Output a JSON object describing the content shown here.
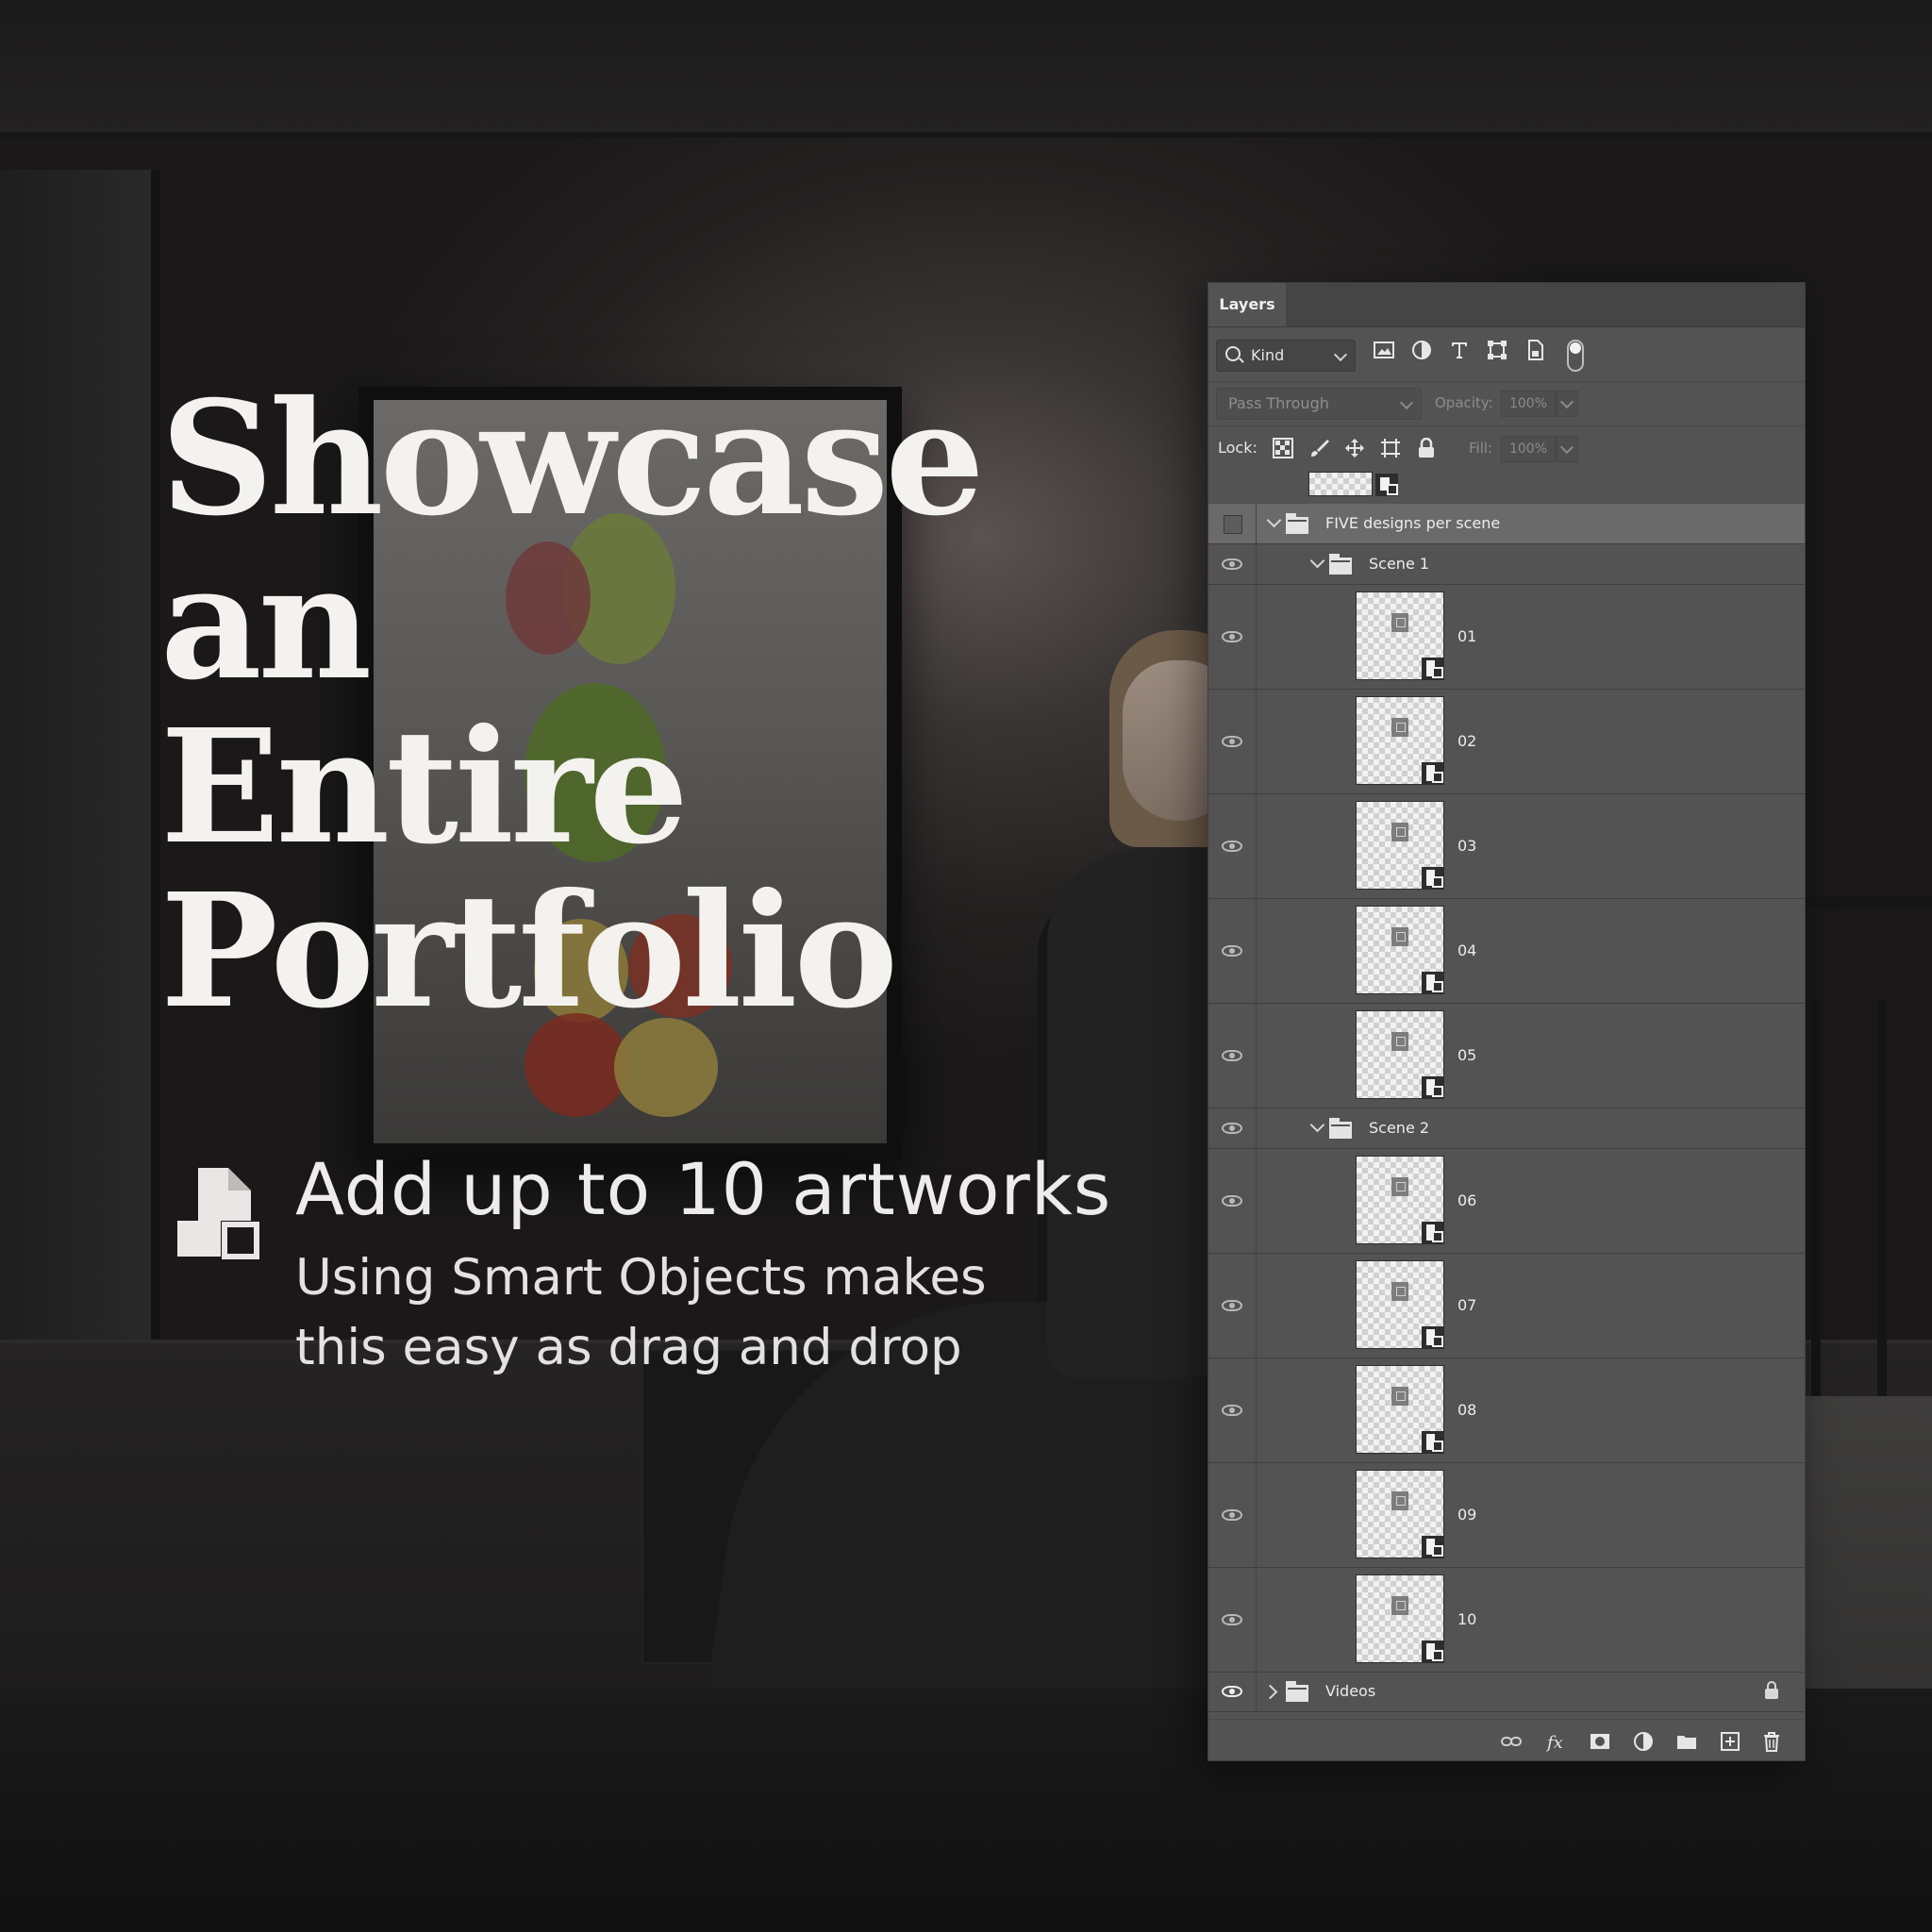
{
  "headline": [
    "Showcase",
    "an Entire",
    "Portfolio"
  ],
  "feature": {
    "icon": "smart-object-icon",
    "title": "Add up to 10 artworks",
    "subtitle": [
      "Using Smart Objects makes",
      "this easy as drag and drop"
    ]
  },
  "panel": {
    "tab": "Layers",
    "filter": {
      "kind_label": "Kind",
      "icons": [
        "image-filter-icon",
        "adjustment-filter-icon",
        "type-filter-icon",
        "shape-filter-icon",
        "smart-object-filter-icon"
      ]
    },
    "blend_mode": "Pass Through",
    "opacity_label": "Opacity:",
    "opacity_value": "100%",
    "lock_label": "Lock:",
    "fill_label": "Fill:",
    "fill_value": "100%",
    "lock_icons": [
      "lock-transparent-icon",
      "lock-paint-icon",
      "lock-move-icon",
      "lock-artboard-icon",
      "lock-all-icon"
    ],
    "layers": [
      {
        "kind": "group",
        "name": "FIVE designs per scene",
        "depth": 0,
        "selected": true,
        "visible": false,
        "expanded": true
      },
      {
        "kind": "group",
        "name": "Scene 1",
        "depth": 1,
        "visible": true,
        "expanded": true
      },
      {
        "kind": "smart",
        "name": "01",
        "visible": true
      },
      {
        "kind": "smart",
        "name": "02",
        "visible": true
      },
      {
        "kind": "smart",
        "name": "03",
        "visible": true
      },
      {
        "kind": "smart",
        "name": "04",
        "visible": true
      },
      {
        "kind": "smart",
        "name": "05",
        "visible": true
      },
      {
        "kind": "group",
        "name": "Scene 2",
        "depth": 1,
        "visible": true,
        "expanded": true
      },
      {
        "kind": "smart",
        "name": "06",
        "visible": true
      },
      {
        "kind": "smart",
        "name": "07",
        "visible": true
      },
      {
        "kind": "smart",
        "name": "08",
        "visible": true
      },
      {
        "kind": "smart",
        "name": "09",
        "visible": true
      },
      {
        "kind": "smart",
        "name": "10",
        "visible": true
      },
      {
        "kind": "group",
        "name": "Videos",
        "depth": 0,
        "visible": true,
        "expanded": false,
        "locked": true
      }
    ],
    "bottom_icons": [
      "link-layers-icon",
      "fx-icon",
      "layer-mask-icon",
      "adjustment-layer-icon",
      "new-group-icon",
      "new-layer-icon",
      "delete-layer-icon"
    ]
  },
  "colors": {
    "panel_bg": "#535353",
    "selected_row": "#6a6a6a",
    "headline_text": "#f4f2ef"
  }
}
